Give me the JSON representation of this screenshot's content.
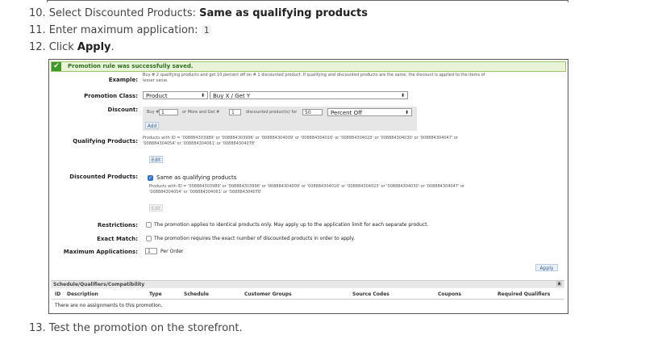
{
  "steps": {
    "s10": {
      "prefix": "10. Select Discounted Products: ",
      "bold": "Same as qualifying products"
    },
    "s11": {
      "prefix": "11. Enter maximum application: ",
      "code": "1"
    },
    "s12": {
      "prefix": "12. Click ",
      "bold": "Apply",
      "suffix": "."
    },
    "s13": {
      "text": "13. Test the promotion on the storefront."
    }
  },
  "screen": {
    "success": "Promotion rule was successfully saved.",
    "example_label": "Example:",
    "example_text_1": "Buy # 2 qualifying products and get 10 percent off on # 1 discounted product. If qualifying and discounted products are the same, the discount is applied to the items of",
    "example_text_2": "lesser value.",
    "promo_class_label": "Promotion Class:",
    "promo_class_value": "Product",
    "promo_type_value": "Buy X / Get Y",
    "discount_label": "Discount:",
    "buy_label": "Buy #",
    "buy_value": "1",
    "more_label": "or More and Get #",
    "get_value": "1",
    "disc_for_label": "discounted product(s) for",
    "amount_value": "50",
    "percent_value": "Percent Off",
    "add_label": "Add",
    "qual_label": "Qualifying Products:",
    "qual_text_1": "Products with ID = '008884303989' or '008884303996' or '008884304009' or '008884304016' or '008884304023' or '008884304030' or '008884304047' or",
    "qual_text_2": "'008884304054' or '008884304061' or '008884304078'",
    "edit_label": "Edit",
    "disc_products_label": "Discounted Products:",
    "same_as_label": "Same as qualifying products",
    "disc_text_1": "Products with ID = '008884303989' or '008884303996' or '008884304009' or '008884304016' or '008884304023' or '008884304030' or '008884304047' or",
    "disc_text_2": "'008884304054' or '008884304061' or '008884304078'",
    "edit2_label": "Edit",
    "restrictions_label": "Restrictions:",
    "restrictions_text": "The promotion applies to identical products only. May apply up to the application limit for each separate product.",
    "exact_label": "Exact Match:",
    "exact_text": "The promotion requires the exact number of discounted products in order to apply.",
    "max_label": "Maximum Applications:",
    "max_value": "1",
    "per_order": "Per Order",
    "apply_label": "Apply",
    "table_title": "Schedule/Qualifiers/Compatibility",
    "columns": [
      "ID",
      "Description",
      "Type",
      "Schedule",
      "Customer Groups",
      "Source Codes",
      "Coupons",
      "Required Qualifiers"
    ],
    "empty_text": "There are no assignments to this promotion."
  }
}
